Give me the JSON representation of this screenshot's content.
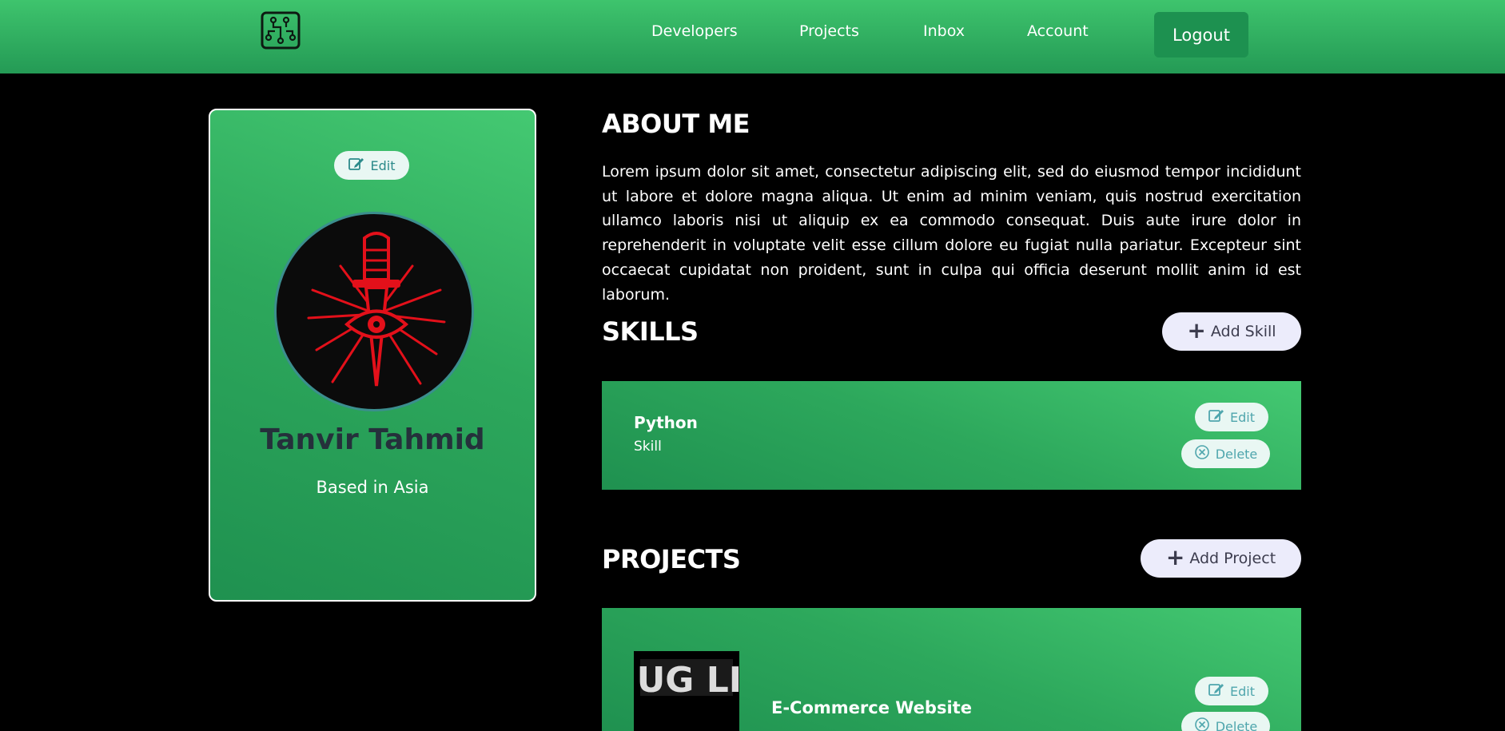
{
  "nav": {
    "links": [
      "Developers",
      "Projects",
      "Inbox",
      "Account"
    ],
    "logout_label": "Logout"
  },
  "profile": {
    "edit_label": "Edit",
    "name": "Tanvir Tahmid",
    "location": "Based in Asia"
  },
  "about": {
    "title": "ABOUT ME",
    "text": "Lorem ipsum dolor sit amet, consectetur adipiscing elit, sed do eiusmod tempor incididunt ut labore et dolore magna aliqua. Ut enim ad minim veniam, quis nostrud exercitation ullamco laboris nisi ut aliquip ex ea commodo consequat. Duis aute irure dolor in reprehenderit in voluptate velit esse cillum dolore eu fugiat nulla pariatur. Excepteur sint occaecat cupidatat non proident, sunt in culpa qui officia deserunt mollit anim id est laborum."
  },
  "skills": {
    "title": "SKILLS",
    "add_label": "Add Skill",
    "items": [
      {
        "name": "Python",
        "subtitle": "Skill",
        "edit_label": "Edit",
        "delete_label": "Delete"
      }
    ]
  },
  "projects": {
    "title": "PROJECTS",
    "add_label": "Add Project",
    "items": [
      {
        "title": "E-Commerce Website",
        "thumb_text": "THUG LIFE",
        "edit_label": "Edit",
        "delete_label": "Delete"
      }
    ]
  },
  "colors": {
    "navbar": "#3ec46d",
    "accent_dark": "#1d9150",
    "pill_bg": "#e9f7f3",
    "add_bg": "#ececfb"
  },
  "icons": [
    "circuit-logo-icon",
    "edit-icon",
    "plus-icon",
    "delete-circle-x-icon",
    "dagger-eye-avatar-icon"
  ]
}
